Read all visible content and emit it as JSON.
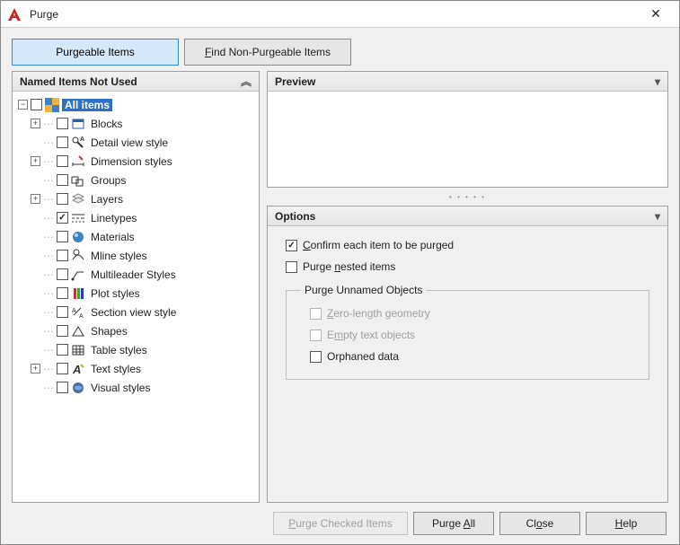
{
  "window": {
    "title": "Purge"
  },
  "tabs": {
    "purgeable_pre": "Pur",
    "purgeable_u": "g",
    "purgeable_post": "eable Items",
    "nonpurgeable_pre": "",
    "nonpurgeable_u": "F",
    "nonpurgeable_post": "ind Non-Purgeable Items"
  },
  "left_header": "Named Items Not Used",
  "tree": {
    "root": "All items",
    "items": [
      {
        "label": "Blocks"
      },
      {
        "label": "Detail view style"
      },
      {
        "label": "Dimension styles"
      },
      {
        "label": "Groups"
      },
      {
        "label": "Layers"
      },
      {
        "label": "Linetypes"
      },
      {
        "label": "Materials"
      },
      {
        "label": "Mline styles"
      },
      {
        "label": "Multileader Styles"
      },
      {
        "label": "Plot styles"
      },
      {
        "label": "Section view style"
      },
      {
        "label": "Shapes"
      },
      {
        "label": "Table styles"
      },
      {
        "label": "Text styles"
      },
      {
        "label": "Visual styles"
      }
    ]
  },
  "preview_header": "Preview",
  "options_header": "Options",
  "options": {
    "confirm_pre": "",
    "confirm_u": "C",
    "confirm_post": "onfirm each item to be purged",
    "nested_pre": "Purge ",
    "nested_u": "n",
    "nested_post": "ested items",
    "group_title": "Purge Unnamed Objects",
    "zero_pre": "",
    "zero_u": "Z",
    "zero_post": "ero-length geometry",
    "empty_pre": "E",
    "empty_u": "m",
    "empty_post": "pty text objects",
    "orphan_label": "Orphaned data"
  },
  "buttons": {
    "purge_checked_pre": "",
    "purge_checked_u": "P",
    "purge_checked_post": "urge Checked Items",
    "purge_all_pre": "Purge ",
    "purge_all_u": "A",
    "purge_all_post": "ll",
    "close_pre": "Cl",
    "close_u": "o",
    "close_post": "se",
    "help_pre": "",
    "help_u": "H",
    "help_post": "elp"
  }
}
